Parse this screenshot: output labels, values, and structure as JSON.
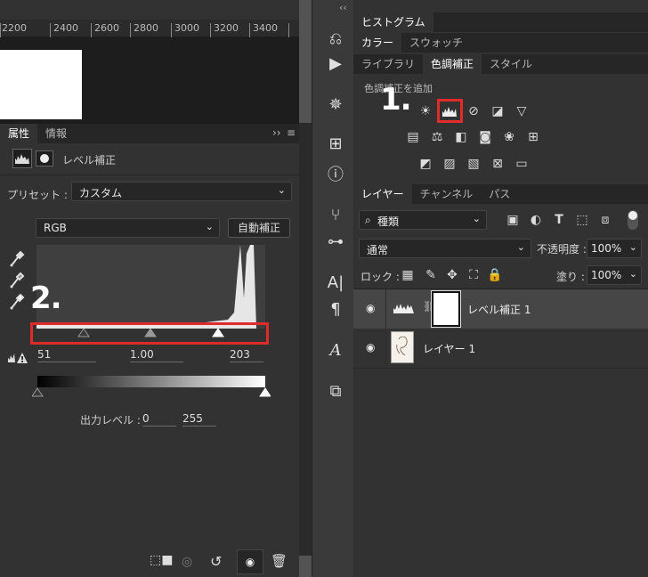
{
  "ruler": {
    "ticks": [
      "2200",
      "2400",
      "2600",
      "2800",
      "3000",
      "3200",
      "3400"
    ]
  },
  "props_panel": {
    "tabs": [
      "属性",
      "情報"
    ],
    "title": "レベル補正",
    "preset_label": "プリセット :",
    "preset_value": "カスタム",
    "channel_value": "RGB",
    "auto_label": "自動補正",
    "input_values": {
      "shadow": "51",
      "midtone": "1.00",
      "highlight": "203"
    },
    "output_label": "出力レベル :",
    "output_values": {
      "low": "0",
      "high": "255"
    },
    "annotation": "2."
  },
  "right_panels": {
    "histogram_tab": "ヒストグラム",
    "color_tabs": [
      "カラー",
      "スウォッチ"
    ],
    "lib_tabs": [
      "ライブラリ",
      "色調補正",
      "スタイル"
    ],
    "adjust_caption": "色調補正を追加",
    "annotation": "1."
  },
  "layers_panel": {
    "tabs": [
      "レイヤー",
      "チャンネル",
      "パス"
    ],
    "filter_value": "種類",
    "blend_mode": "通常",
    "opacity_label": "不透明度 :",
    "opacity_value": "100%",
    "lock_label": "ロック :",
    "fill_label": "塗り :",
    "fill_value": "100%",
    "layers": [
      {
        "name": "レベル補正 1"
      },
      {
        "name": "レイヤー 1"
      }
    ]
  },
  "colors": {
    "accent_red": "#e02b2b",
    "panel": "#323232",
    "dark": "#262626"
  }
}
